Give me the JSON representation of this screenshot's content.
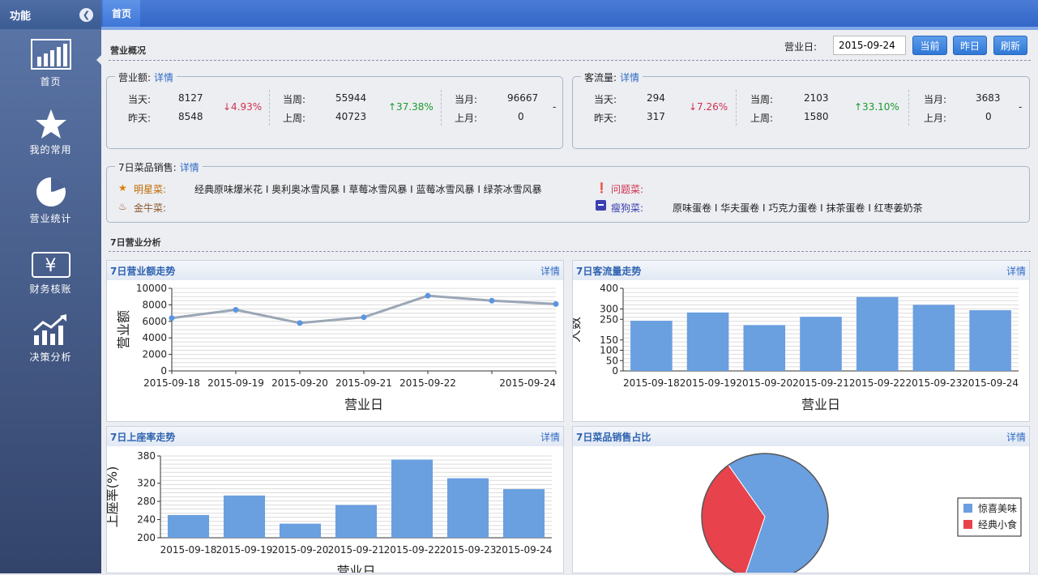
{
  "sidebar": {
    "title": "功能",
    "items": [
      {
        "label": "首页"
      },
      {
        "label": "我的常用"
      },
      {
        "label": "营业统计"
      },
      {
        "label": "财务核账"
      },
      {
        "label": "决策分析"
      }
    ]
  },
  "tabs": [
    {
      "label": "首页"
    }
  ],
  "overview": {
    "title": "营业概况",
    "date_label": "营业日:",
    "date_value": "2015-09-24",
    "buttons": {
      "current": "当前",
      "yesterday": "昨日",
      "refresh": "刷新"
    }
  },
  "revenue": {
    "title": "营业额:",
    "link": "详情",
    "day": {
      "l1": "当天:",
      "v1": "8127",
      "l2": "昨天:",
      "v2": "8548",
      "change": "↓4.93%"
    },
    "week": {
      "l1": "当周:",
      "v1": "55944",
      "l2": "上周:",
      "v2": "40723",
      "change": "↑37.38%"
    },
    "month": {
      "l1": "当月:",
      "v1": "96667",
      "l2": "上月:",
      "v2": "0",
      "change": "-"
    }
  },
  "traffic": {
    "title": "客流量:",
    "link": "详情",
    "day": {
      "l1": "当天:",
      "v1": "294",
      "l2": "昨天:",
      "v2": "317",
      "change": "↓7.26%"
    },
    "week": {
      "l1": "当周:",
      "v1": "2103",
      "l2": "上周:",
      "v2": "1580",
      "change": "↑33.10%"
    },
    "month": {
      "l1": "当月:",
      "v1": "3683",
      "l2": "上月:",
      "v2": "0",
      "change": "-"
    }
  },
  "dish": {
    "title": "7日菜品销售:",
    "link": "详情",
    "star_label": "明星菜:",
    "star_items": "经典原味爆米花 I 奥利奥冰雪风暴 I 草莓冰雪风暴 I 蓝莓冰雪风暴 I 绿茶冰雪风暴",
    "cow_label": "金牛菜:",
    "problem_label": "问题菜:",
    "dog_label": "瘦狗菜:",
    "dog_items": "原味蛋卷 I 华夫蛋卷 I 巧克力蛋卷 I 抹茶蛋卷 I 红枣姜奶茶"
  },
  "analysis": {
    "title": "7日营业分析"
  },
  "panels": {
    "revenue": {
      "title": "7日营业额走势",
      "link": "详情"
    },
    "traffic": {
      "title": "7日客流量走势",
      "link": "详情"
    },
    "seat": {
      "title": "7日上座率走势",
      "link": "详情"
    },
    "share": {
      "title": "7日菜品销售占比",
      "link": "详情"
    }
  },
  "colors": {
    "bar": "#6a9fe0",
    "line": "#9aa6b5",
    "point": "#5b96e0",
    "pie_a": "#6a9fe0",
    "pie_b": "#e8424c",
    "red": "#d0304f",
    "green": "#1c9b2c"
  },
  "chart_data": [
    {
      "type": "line",
      "title": "7日营业额走势",
      "xlabel": "营业日",
      "ylabel": "营业额",
      "categories": [
        "2015-09-18",
        "2015-09-19",
        "2015-09-20",
        "2015-09-21",
        "2015-09-22",
        "2015-09-23",
        "2015-09-24"
      ],
      "tick_labels": [
        "2015-09-18",
        "2015-09-19",
        "2015-09-20",
        "2015-09-21",
        "2015-09-22",
        "",
        "2015-09-24"
      ],
      "values": [
        6400,
        7400,
        5800,
        6500,
        9100,
        8500,
        8100
      ],
      "ylim": [
        0,
        10000
      ],
      "yticks": [
        0,
        2000,
        4000,
        6000,
        8000,
        10000
      ],
      "grid": true
    },
    {
      "type": "bar",
      "title": "7日客流量走势",
      "xlabel": "营业日",
      "ylabel": "人数",
      "categories": [
        "2015-09-18",
        "2015-09-19",
        "2015-09-20",
        "2015-09-21",
        "2015-09-22",
        "2015-09-23",
        "2015-09-24"
      ],
      "values": [
        243,
        283,
        222,
        262,
        358,
        320,
        294
      ],
      "ylim": [
        0,
        400
      ],
      "yticks": [
        0,
        50,
        100,
        150,
        250,
        300,
        400
      ],
      "grid": true
    },
    {
      "type": "bar",
      "title": "7日上座率走势",
      "xlabel": "营业日",
      "ylabel": "上座率(%)",
      "categories": [
        "2015-09-18",
        "2015-09-19",
        "2015-09-20",
        "2015-09-21",
        "2015-09-22",
        "2015-09-23",
        "2015-09-24"
      ],
      "values": [
        250,
        293,
        231,
        272,
        372,
        331,
        307
      ],
      "ylim": [
        200,
        380
      ],
      "yticks": [
        200,
        240,
        280,
        320,
        380
      ],
      "grid": true
    },
    {
      "type": "pie",
      "title": "7日菜品销售占比",
      "legend": "right",
      "series": [
        {
          "name": "惊喜美味",
          "value": 65
        },
        {
          "name": "经典小食",
          "value": 35
        }
      ]
    }
  ]
}
